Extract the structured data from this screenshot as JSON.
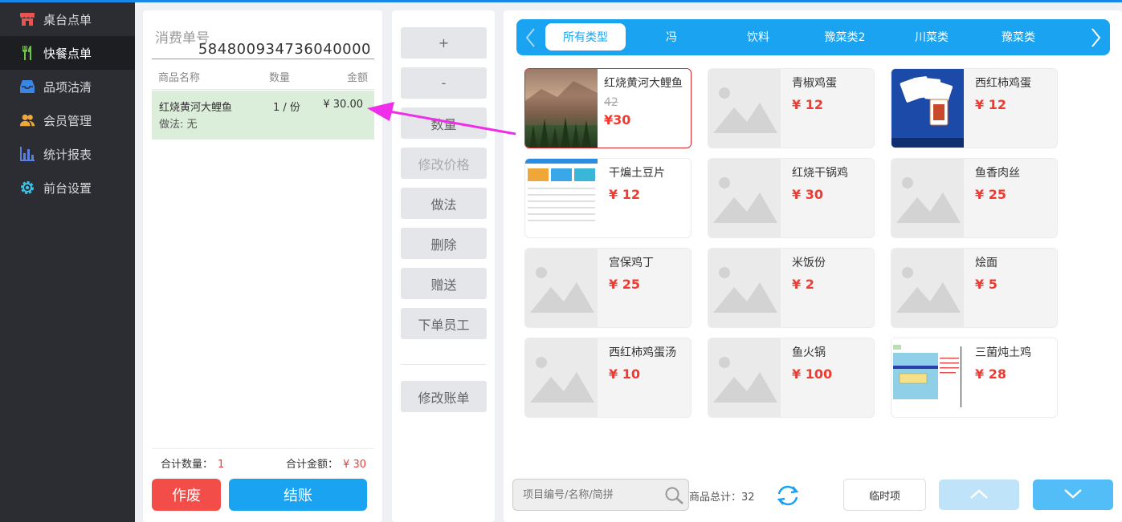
{
  "sidebar": {
    "items": [
      {
        "label": "桌台点单",
        "icon": "store-icon",
        "color": "#e85550"
      },
      {
        "label": "快餐点单",
        "icon": "fork-knife-icon",
        "color": "#6fc24a",
        "active": true
      },
      {
        "label": "品项沽清",
        "icon": "inbox-icon",
        "color": "#3a86e8"
      },
      {
        "label": "会员管理",
        "icon": "users-icon",
        "color": "#f0a73a"
      },
      {
        "label": "统计报表",
        "icon": "bar-chart-icon",
        "color": "#5a7fe0"
      },
      {
        "label": "前台设置",
        "icon": "gear-icon",
        "color": "#3cc4e6"
      }
    ]
  },
  "order": {
    "no_label": "消费单号",
    "no": "584800934736040000",
    "col_name": "商品名称",
    "col_qty": "数量",
    "col_amount": "金额",
    "rows": [
      {
        "name": "红烧黄河大鲤鱼",
        "qty": "1 / 份",
        "amount": "¥ 30.00",
        "method": "做法: 无"
      }
    ],
    "total_qty_label": "合计数量：",
    "total_qty": "1",
    "total_amount_label": "合计金额：",
    "total_amount": "¥ 30",
    "void_label": "作废",
    "pay_label": "结账"
  },
  "actions": {
    "plus": "+",
    "minus": "-",
    "quantity": "数量",
    "edit_price": "修改价格",
    "method": "做法",
    "delete": "删除",
    "gift": "赠送",
    "staff": "下单员工",
    "edit_bill": "修改账单"
  },
  "categories": {
    "items": [
      "所有类型",
      "冯",
      "饮料",
      "豫菜类2",
      "川菜类",
      "豫菜类"
    ],
    "active_index": 0
  },
  "products": [
    {
      "name": "红烧黄河大鲤鱼",
      "old_price": "42",
      "price": "¥30",
      "thumb": "landscape",
      "selected": true
    },
    {
      "name": "青椒鸡蛋",
      "price": "¥ 12",
      "thumb": "placeholder"
    },
    {
      "name": "西红柿鸡蛋",
      "price": "¥ 12",
      "thumb": "cards"
    },
    {
      "name": "干煸土豆片",
      "price": "¥ 12",
      "thumb": "dashboard"
    },
    {
      "name": "红烧干锅鸡",
      "price": "¥ 30",
      "thumb": "placeholder"
    },
    {
      "name": "鱼香肉丝",
      "price": "¥ 25",
      "thumb": "placeholder"
    },
    {
      "name": "宫保鸡丁",
      "price": "¥ 25",
      "thumb": "placeholder"
    },
    {
      "name": "米饭份",
      "price": "¥ 2",
      "thumb": "placeholder"
    },
    {
      "name": "烩面",
      "price": "¥ 5",
      "thumb": "placeholder"
    },
    {
      "name": "西红柿鸡蛋汤",
      "price": "¥ 10",
      "thumb": "placeholder"
    },
    {
      "name": "鱼火锅",
      "price": "¥ 100",
      "thumb": "placeholder"
    },
    {
      "name": "三菌炖土鸡",
      "price": "¥ 28",
      "thumb": "screenshot"
    }
  ],
  "footer": {
    "search_placeholder": "项目编号/名称/简拼",
    "total_items": "商品总计：32",
    "temp_label": "临时项"
  },
  "colors": {
    "accent": "#1aa3f0",
    "danger": "#f34d4a",
    "price": "#f0392f",
    "selected_row": "#daeed9",
    "arrow": "#ee2ee8"
  }
}
